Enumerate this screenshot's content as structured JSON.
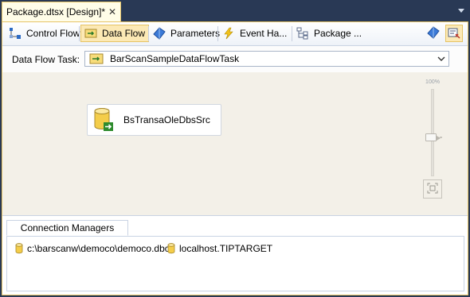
{
  "document_tab": {
    "title": "Package.dtsx [Design]*",
    "close_glyph": "✕"
  },
  "designer_tabs": [
    {
      "label": "Control Flow",
      "icon": "control-flow-icon",
      "active": false
    },
    {
      "label": "Data Flow",
      "icon": "data-flow-icon",
      "active": true
    },
    {
      "label": "Parameters",
      "icon": "parameters-icon",
      "active": false
    },
    {
      "label": "Event Ha...",
      "icon": "event-handlers-icon",
      "active": false
    },
    {
      "label": "Package ...",
      "icon": "package-explorer-icon",
      "active": false
    }
  ],
  "data_flow_task": {
    "label": "Data Flow Task:",
    "selected": "BarScanSampleDataFlowTask"
  },
  "canvas": {
    "components": [
      {
        "name": "BsTransaOleDbsSrc",
        "icon": "ole-db-source-icon"
      }
    ],
    "zoom_label": "100%",
    "zoom_level_percent": 100
  },
  "connection_managers": {
    "tab_label": "Connection Managers",
    "items": [
      {
        "label": "c:\\barscanw\\democo\\democo.dbc",
        "icon": "database-icon"
      },
      {
        "label": "localhost.TIPTARGET",
        "icon": "database-icon"
      }
    ]
  },
  "colors": {
    "frame_background": "#293955",
    "active_tab": "#fce9b5",
    "active_border": "#e5c365",
    "canvas": "#f3f0e8"
  }
}
